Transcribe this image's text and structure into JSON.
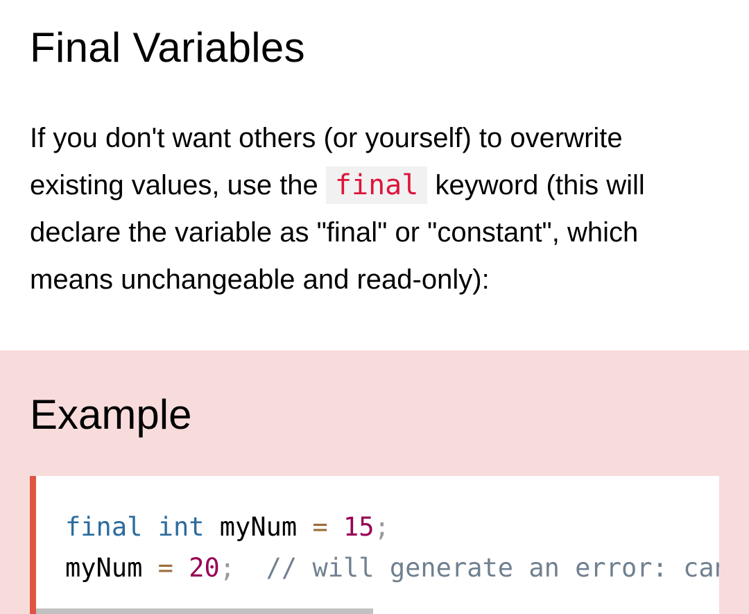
{
  "heading": "Final Variables",
  "intro": {
    "before": "If you don't want others (or yourself) to overwrite existing values, use the ",
    "keyword": "final",
    "after": " keyword (this will declare the variable as \"final\" or \"constant\", which means unchangeable and read-only):"
  },
  "example": {
    "heading": "Example",
    "code": {
      "line1": {
        "kw1": "final",
        "kw2": "int",
        "ident": "myNum",
        "op": "=",
        "num": "15",
        "semi": ";"
      },
      "line2": {
        "ident": "myNum",
        "op": "=",
        "num": "20",
        "semi": ";",
        "comment": "// will generate an error: cannot assign a value to a final variable"
      }
    }
  },
  "colors": {
    "example_background": "#f8dcdc",
    "code_border_accent": "#e05541",
    "inline_code_text": "#dc143c",
    "keyword": "#2a6b9e",
    "number": "#990055",
    "comment": "#708090"
  }
}
